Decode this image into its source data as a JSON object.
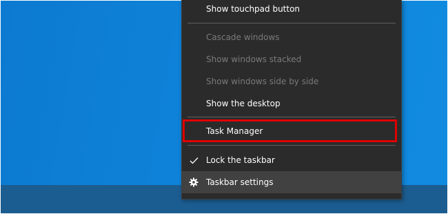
{
  "context_menu": {
    "items": [
      {
        "label": "Show touchpad button",
        "enabled": true
      },
      {
        "label": "Cascade windows",
        "enabled": false
      },
      {
        "label": "Show windows stacked",
        "enabled": false
      },
      {
        "label": "Show windows side by side",
        "enabled": false
      },
      {
        "label": "Show the desktop",
        "enabled": true
      },
      {
        "label": "Task Manager",
        "enabled": true,
        "highlighted": true
      },
      {
        "label": "Lock the taskbar",
        "enabled": true,
        "checked": true,
        "icon": "checkmark-icon"
      },
      {
        "label": "Taskbar settings",
        "enabled": true,
        "hovered": true,
        "icon": "gear-icon"
      }
    ]
  },
  "colors": {
    "menu_background": "#2b2b2b",
    "hover_background": "#414141",
    "disabled_text": "#7a7a7a",
    "highlight_border": "#e00000",
    "desktop_blue": "#0f86dc",
    "taskbar": "#1c5d91"
  }
}
